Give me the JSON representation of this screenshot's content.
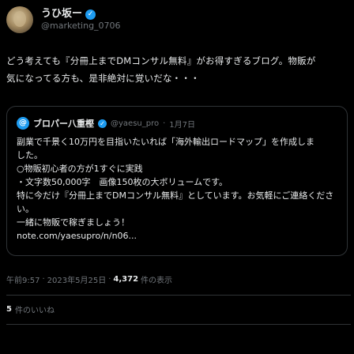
{
  "author": {
    "display_name": "うひ坂ー",
    "verified_mark": "✓",
    "handle": "@marketing_0706"
  },
  "body": {
    "lines": [
      "どう考えても『分冊上までDMコンサル無料』がお得すぎるブログ。物販が",
      "気になってる方も、是非絶対に覚いだな・・・"
    ]
  },
  "quote": {
    "avatar_glyph": "@",
    "display_name": "ブロパー八重樫",
    "verified_mark": "✓",
    "handle": "@yaesu_pro",
    "dot": "·",
    "date": "1月7日",
    "lines": [
      "副業で千景く10万円を目指いたいれば「海外輸出ロードマップ」を作成しま",
      "した。",
      "○物販初心者の方が1すぐに実践",
      "・文字数50,000字　画像150枚の大ボリュームです。",
      "特に今だけ『分冊上までDMコンサル無料』としています。お気軽にご連絡くださ",
      "い。",
      "一緒に物販で稼ぎましょう！",
      "note.com/yaesupro/n/n06..."
    ]
  },
  "meta": {
    "time": "午前9:57",
    "sep1": "·",
    "date": "2023年5月25日",
    "sep2": "·",
    "views_count": "4,372",
    "views_label": "件の表示"
  },
  "likes": {
    "count": "5",
    "label": "件のいいね"
  },
  "colors": {
    "background": "#000000",
    "text": "#e7e9ea",
    "muted": "#71767b",
    "border": "#2f3336",
    "accent": "#1d9bf0"
  }
}
